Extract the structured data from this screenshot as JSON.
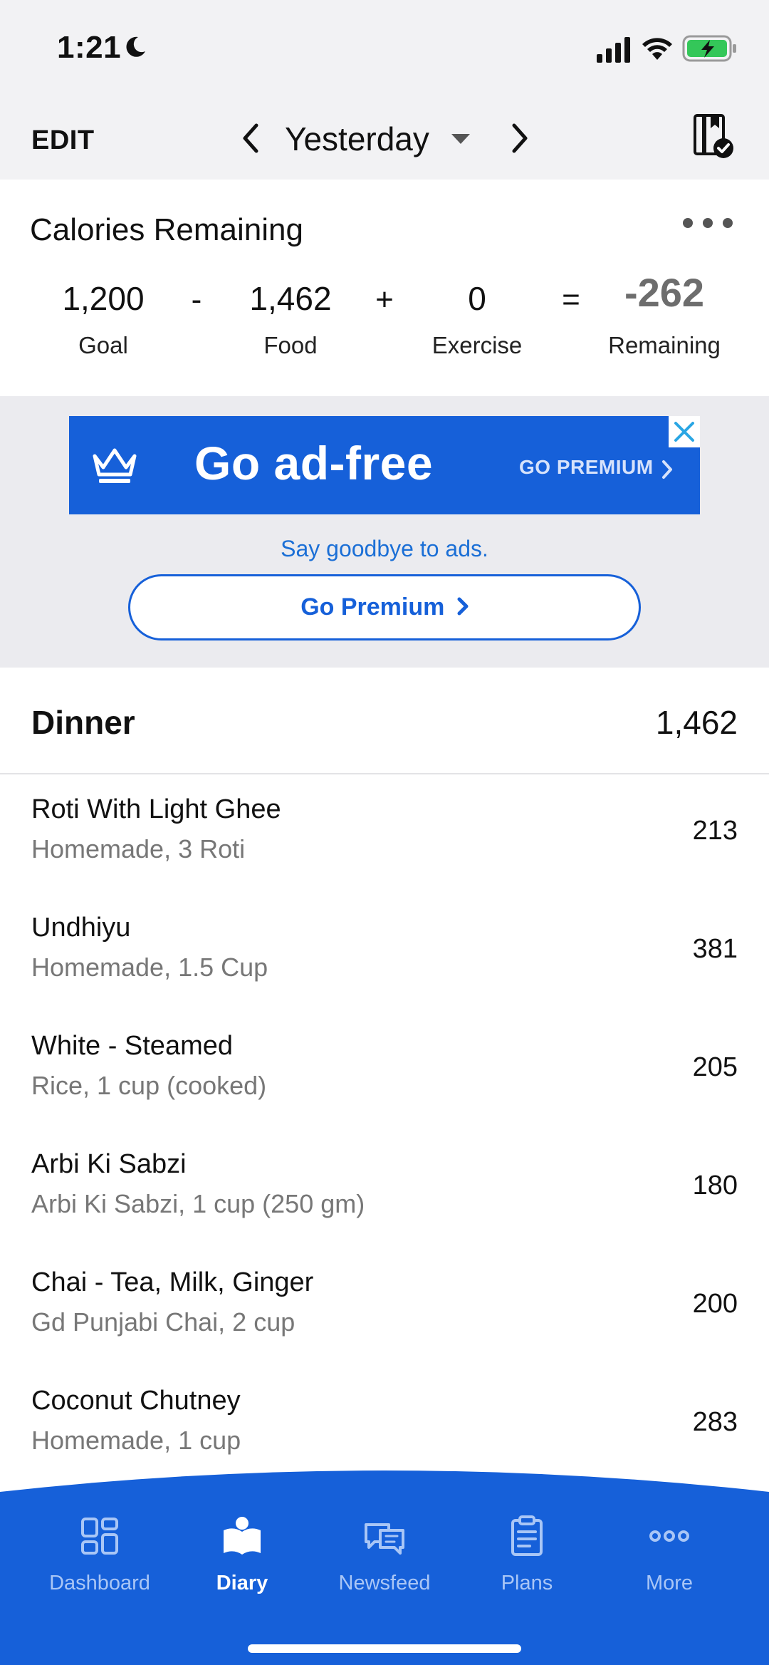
{
  "status_bar": {
    "time": "1:21"
  },
  "header": {
    "edit_label": "EDIT",
    "date_label": "Yesterday"
  },
  "calories": {
    "title": "Calories Remaining",
    "goal": {
      "value": "1,200",
      "label": "Goal"
    },
    "op_minus": "-",
    "food": {
      "value": "1,462",
      "label": "Food"
    },
    "op_plus": "+",
    "exercise": {
      "value": "0",
      "label": "Exercise"
    },
    "op_equals": "=",
    "remaining": {
      "value": "-262",
      "label": "Remaining"
    }
  },
  "ad": {
    "headline": "Go ad-free",
    "cta": "GO PREMIUM",
    "tagline": "Say goodbye to ads.",
    "button_label": "Go Premium"
  },
  "meal": {
    "title": "Dinner",
    "total": "1,462",
    "items": [
      {
        "name": "Roti With Light Ghee",
        "detail": "Homemade, 3 Roti",
        "calories": "213"
      },
      {
        "name": "Undhiyu",
        "detail": "Homemade, 1.5 Cup",
        "calories": "381"
      },
      {
        "name": "White - Steamed",
        "detail": "Rice, 1 cup (cooked)",
        "calories": "205"
      },
      {
        "name": "Arbi Ki Sabzi",
        "detail": "Arbi Ki Sabzi, 1 cup (250 gm)",
        "calories": "180"
      },
      {
        "name": "Chai - Tea, Milk, Ginger",
        "detail": "Gd Punjabi Chai, 2 cup",
        "calories": "200"
      },
      {
        "name": "Coconut Chutney",
        "detail": "Homemade, 1 cup",
        "calories": "283"
      }
    ]
  },
  "nav": {
    "items": [
      {
        "label": "Dashboard",
        "icon": "dashboard-icon"
      },
      {
        "label": "Diary",
        "icon": "diary-icon",
        "active": true
      },
      {
        "label": "Newsfeed",
        "icon": "newsfeed-icon"
      },
      {
        "label": "Plans",
        "icon": "plans-icon"
      },
      {
        "label": "More",
        "icon": "more-icon"
      }
    ]
  },
  "colors": {
    "brand_blue": "#1660d9",
    "remaining_gray": "#6d6d6d",
    "battery_green": "#34c759"
  }
}
